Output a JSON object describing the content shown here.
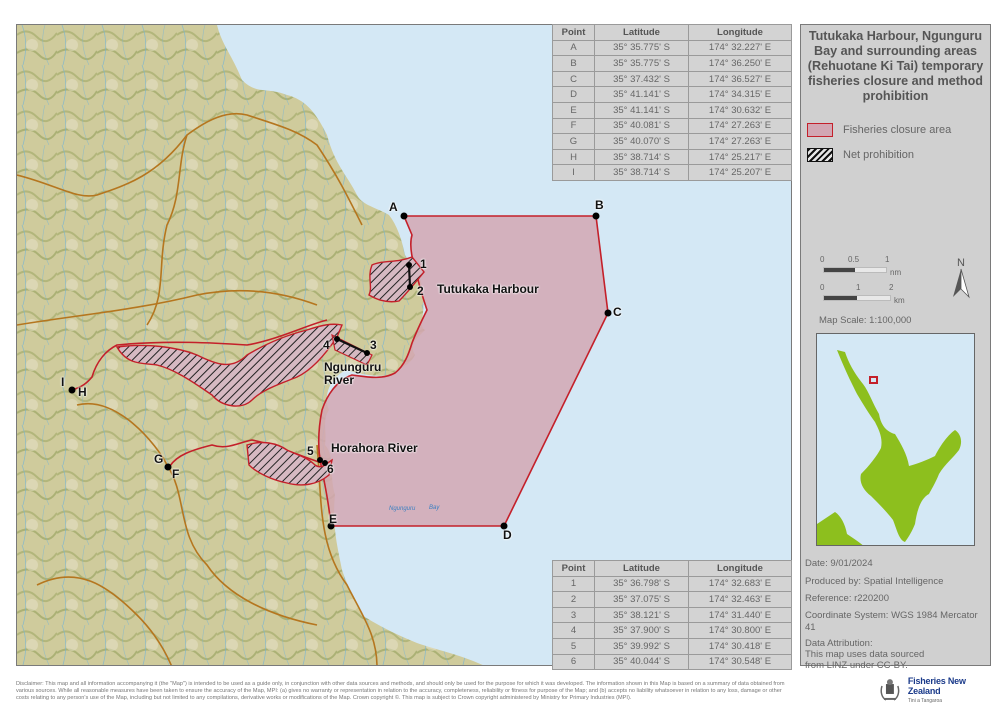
{
  "title": "Tutukaka Harbour, Ngunguru Bay and surrounding areas (Rehuotane Ki Tai) temporary fisheries closure and method prohibition",
  "legend": {
    "closure_label": "Fisheries closure area",
    "net_label": "Net prohibition",
    "closure_fill": "#d2a7b3",
    "closure_stroke": "#c4202a"
  },
  "table_points": {
    "headers": [
      "Point",
      "Latitude",
      "Longitude"
    ],
    "rows": [
      [
        "A",
        "35° 35.775' S",
        "174° 32.227' E"
      ],
      [
        "B",
        "35° 35.775' S",
        "174° 36.250' E"
      ],
      [
        "C",
        "35° 37.432' S",
        "174° 36.527' E"
      ],
      [
        "D",
        "35° 41.141' S",
        "174° 34.315' E"
      ],
      [
        "E",
        "35° 41.141' S",
        "174° 30.632' E"
      ],
      [
        "F",
        "35° 40.081' S",
        "174° 27.263' E"
      ],
      [
        "G",
        "35° 40.070' S",
        "174° 27.263' E"
      ],
      [
        "H",
        "35° 38.714' S",
        "174° 25.217' E"
      ],
      [
        "I",
        "35° 38.714' S",
        "174° 25.207' E"
      ]
    ]
  },
  "table_net_points": {
    "headers": [
      "Point",
      "Latitude",
      "Longitude"
    ],
    "rows": [
      [
        "1",
        "35° 36.798' S",
        "174° 32.683' E"
      ],
      [
        "2",
        "35° 37.075' S",
        "174° 32.463' E"
      ],
      [
        "3",
        "35° 38.121' S",
        "174° 31.440' E"
      ],
      [
        "4",
        "35° 37.900' S",
        "174° 30.800' E"
      ],
      [
        "5",
        "35° 39.992' S",
        "174° 30.418' E"
      ],
      [
        "6",
        "35° 40.044' S",
        "174° 30.548' E"
      ]
    ]
  },
  "scale": {
    "nm_ticks": [
      "0",
      "0.5",
      "1"
    ],
    "nm_unit": "nm",
    "km_ticks": [
      "0",
      "1",
      "2"
    ],
    "km_unit": "km",
    "north_label": "N",
    "map_scale": "Map Scale: 1:100,000"
  },
  "map_labels": {
    "tutukaka": "Tutukaka Harbour",
    "ngunguru_1": "Ngunguru",
    "ngunguru_2": "River",
    "horahora": "Horahora River",
    "bay_1": "Ngunguru",
    "bay_2": "Bay"
  },
  "point_labels": [
    "A",
    "B",
    "C",
    "D",
    "E",
    "F",
    "G",
    "H",
    "I",
    "1",
    "2",
    "3",
    "4",
    "5",
    "6"
  ],
  "meta": {
    "date": "Date: 9/01/2024",
    "produced_by": "Produced by: Spatial Intelligence",
    "reference": "Reference: r220200",
    "coord_system_1": "Coordinate System: WGS 1984 Mercator",
    "coord_system_2": "41",
    "attribution_1": "Data Attribution:",
    "attribution_2": "This map uses data sourced",
    "attribution_3": "from LINZ under CC-BY."
  },
  "disclaimer": "Disclaimer: This map and all information accompanying it (the \"Map\") is intended to be used as a guide only, in conjunction with other data sources and methods, and should only be used for the purpose for which it was developed.  The information shown in this Map is based on a summary of data obtained from various sources.  While all reasonable measures have been taken to ensure the accuracy of the Map, MPI: (a) gives no warranty or representation in relation to the accuracy, completeness, reliability or fitness for purpose of the Map; and (b) accepts no liability whatsoever in relation to any loss, damage or other costs relating to any person's use of the Map, including but not limited to any compilations, derivative works or modifications of the Map. Crown copyright ©. This map is subject to Crown copyright administered by Ministry for Primary Industries (MPI).",
  "logo": {
    "name": "Fisheries New Zealand",
    "sub": "Tini a Tangaroa",
    "color": "#1a3a8a"
  },
  "colors": {
    "sea": "#d4e8f5",
    "land": "#c9c79a",
    "land_dark": "#a9ad6f",
    "inset_land": "#8dbf1e",
    "road": "#b5761f",
    "river": "#6fb3d9"
  }
}
